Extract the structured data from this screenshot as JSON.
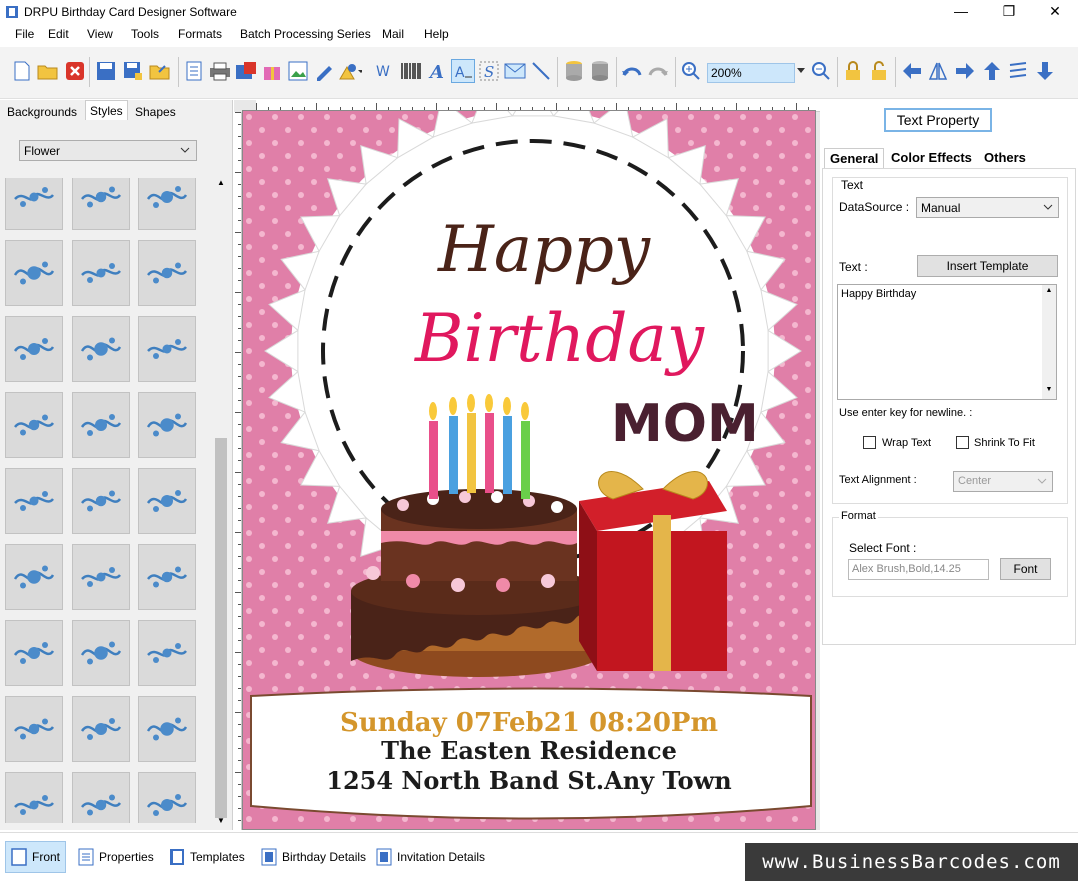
{
  "window": {
    "title": "DRPU Birthday Card Designer Software",
    "minimize": "—",
    "maximize": "❐",
    "close": "✕"
  },
  "menu": [
    "File",
    "Edit",
    "View",
    "Tools",
    "Formats",
    "Batch Processing Series",
    "Mail",
    "Help"
  ],
  "toolbar": {
    "zoom": "200%"
  },
  "left_panel": {
    "tabs": [
      "Backgrounds",
      "Styles",
      "Shapes"
    ],
    "active_tab": "Styles",
    "style_category": "Flower"
  },
  "card": {
    "line1": "Happy",
    "line2": "Birthday",
    "line3": "MOM",
    "date": "Sunday 07Feb21 08:20Pm",
    "venue": "The Easten Residence",
    "address": "1254 North Band St.Any Town",
    "colors": {
      "background": "#e07fa8",
      "happy": "#4a2318",
      "birthday": "#e0185e",
      "mom": "#4a2030",
      "date": "#d4962c"
    }
  },
  "right_panel": {
    "header": "Text Property",
    "tabs": [
      "General",
      "Color Effects",
      "Others"
    ],
    "text_group": "Text",
    "datasource_label": "DataSource :",
    "datasource_value": "Manual",
    "text_label": "Text :",
    "insert_template": "Insert Template",
    "text_value": "Happy Birthday",
    "newline_hint": "Use enter key for newline. :",
    "wrap_text": "Wrap Text",
    "shrink_to_fit": "Shrink To Fit",
    "alignment_label": "Text Alignment :",
    "alignment_value": "Center",
    "format_group": "Format",
    "select_font_label": "Select Font :",
    "font_value": "Alex Brush,Bold,14.25",
    "font_button": "Font"
  },
  "bottom_tabs": [
    "Front",
    "Properties",
    "Templates",
    "Birthday Details",
    "Invitation Details"
  ],
  "brand": "www.BusinessBarcodes.com"
}
